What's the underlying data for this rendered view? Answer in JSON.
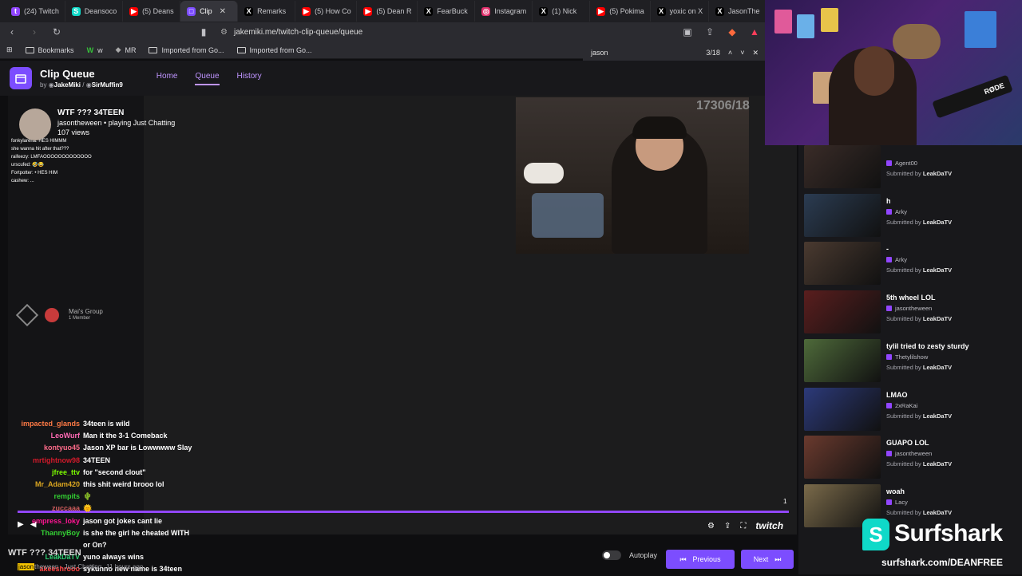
{
  "browser": {
    "tabs": [
      {
        "label": "(24) Twitch",
        "color": "#9146ff",
        "glyph": "t"
      },
      {
        "label": "Deansoco",
        "color": "#0fd9c8",
        "glyph": "S"
      },
      {
        "label": "(5) Deans",
        "color": "#ff0000",
        "glyph": "▶"
      },
      {
        "label": "Clip",
        "color": "#7c4dff",
        "glyph": "□",
        "active": true
      },
      {
        "label": "Remarks",
        "color": "#000000",
        "glyph": "X"
      },
      {
        "label": "(5) How Co",
        "color": "#ff0000",
        "glyph": "▶"
      },
      {
        "label": "(5) Dean R",
        "color": "#ff0000",
        "glyph": "▶"
      },
      {
        "label": "FearBuck",
        "color": "#000000",
        "glyph": "X"
      },
      {
        "label": "Instagram",
        "color": "#e1306c",
        "glyph": "◎"
      },
      {
        "label": "(1) Nick",
        "color": "#000000",
        "glyph": "X"
      },
      {
        "label": "(5) Pokima",
        "color": "#ff0000",
        "glyph": "▶"
      },
      {
        "label": "yoxic on X",
        "color": "#000000",
        "glyph": "X"
      },
      {
        "label": "JasonThe",
        "color": "#000000",
        "glyph": "X"
      }
    ],
    "url": "jakemiki.me/twitch-clip-queue/queue",
    "bookmarks": [
      "Bookmarks",
      "w",
      "MR",
      "Imported from Go...",
      "Imported from Go..."
    ],
    "find": {
      "query": "jason",
      "count": "3/18"
    }
  },
  "app": {
    "title": "Clip Queue",
    "by_label": "by",
    "author1": "JakeMiki",
    "author2": "SirMuffin9",
    "nav": [
      "Home",
      "Queue",
      "History"
    ]
  },
  "player": {
    "count_overlay": "17306/18",
    "clip_title": "WTF ??? 34TEEN",
    "clip_channel_line": "jasontheween • playing Just Chatting",
    "clip_views": "107 views",
    "mini_chat": [
      "fonkylarena: HES HIMMM",
      "she wanna hit after that???",
      "raifeezy: LMFAOOOOOOOOOOOOO",
      "urscufed: 🤣😂",
      "Fortpotter: • HES HIM",
      "cashew: ..."
    ],
    "group_name": "Mai's Group",
    "group_members": "1 Member",
    "number": "1",
    "brand_word": "twitch"
  },
  "chat": [
    {
      "user": "impacted_glands",
      "color": "#ff7a45",
      "msg": "34teen is wild"
    },
    {
      "user": "LeoWurf",
      "color": "#ff69b4",
      "msg": "Man it the 3-1 Comeback"
    },
    {
      "user": "kontyuo45",
      "color": "#ff6b8a",
      "msg": "Jason XP bar is Lowwwww Slay"
    },
    {
      "user": "mrtightnow98",
      "color": "#d11a2a",
      "msg": "34TEEN"
    },
    {
      "user": "jfree_ttv",
      "color": "#7cfc00",
      "msg": "for \"second clout\""
    },
    {
      "user": "Mr_Adam420",
      "color": "#daa520",
      "msg": "this shit weird brooo lol"
    },
    {
      "user": "rempits",
      "color": "#32cd32",
      "msg": "🌵"
    },
    {
      "user": "zuccaaa",
      "color": "#cd5c5c",
      "msg": "🌞"
    },
    {
      "user": "empress_loky",
      "color": "#ff1493",
      "msg": "jason got jokes cant lie"
    },
    {
      "user": "ThannyBoy",
      "color": "#32cd32",
      "msg": "is she the girl he cheated WITH"
    },
    {
      "user": "",
      "color": "#ffffff",
      "msg": "or On?"
    },
    {
      "user": "LeakDaTV",
      "color": "#2ecc71",
      "msg": "yuno always wins"
    },
    {
      "user": "akeeshrooo",
      "color": "#ff4040",
      "msg": "sykunno new name is 34teen"
    }
  ],
  "below": {
    "title": "WTF ??? 34TEEN",
    "highlight": "jason",
    "meta_rest": "theween · Just Chatting",
    "time": "11 hours ago"
  },
  "controls": {
    "autoplay": "Autoplay",
    "previous": "Previous",
    "next": "Next"
  },
  "sidebar": [
    {
      "title": "",
      "channel": "Agent00",
      "submitter": "LeakDaTV",
      "thumb": "#3a2c28"
    },
    {
      "title": "h",
      "channel": "Arky",
      "submitter": "LeakDaTV",
      "thumb": "#2b3c52"
    },
    {
      "title": "-",
      "channel": "Arky",
      "submitter": "LeakDaTV",
      "thumb": "#4a3a30"
    },
    {
      "title": "5th wheel LOL",
      "channel": "jasontheween",
      "submitter": "LeakDaTV",
      "thumb": "#5a1e1e"
    },
    {
      "title": "tylil tried to zesty sturdy",
      "channel": "Thetylilshow",
      "submitter": "LeakDaTV",
      "thumb": "#4e6a3a"
    },
    {
      "title": "LMAO",
      "channel": "2xRaKai",
      "submitter": "LeakDaTV",
      "thumb": "#2c3a7a"
    },
    {
      "title": "GUAPO LOL",
      "channel": "jasontheween",
      "submitter": "LeakDaTV",
      "thumb": "#6a3a2e"
    },
    {
      "title": "woah",
      "channel": "Lacy",
      "submitter": "LeakDaTV",
      "thumb": "#7a6a4a"
    }
  ],
  "sidebar_submitted_label": "Submitted by",
  "webcam": {
    "mic_label": "RØDE"
  },
  "sponsor": {
    "word": "Surfshark",
    "url": "surfshark.com/DEANFREE"
  }
}
